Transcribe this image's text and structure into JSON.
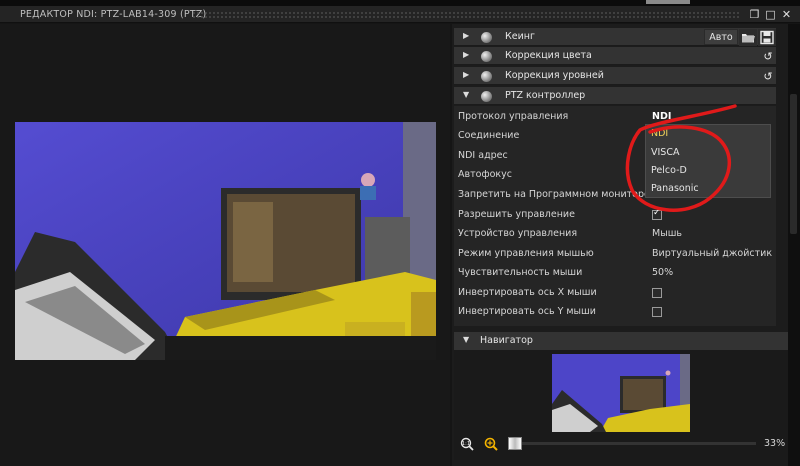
{
  "window": {
    "title": "РЕДАКТОР NDI: PTZ-LAB14-309 (PTZ)",
    "buttons": {
      "restore": "❐",
      "maximize": "□",
      "close": "✕"
    }
  },
  "sections": [
    {
      "label": "Кеинг",
      "expanded": false
    },
    {
      "label": "Коррекция цвета",
      "expanded": false
    },
    {
      "label": "Коррекция уровней",
      "expanded": false
    },
    {
      "label": "PTZ контроллер",
      "expanded": true
    }
  ],
  "toolbar": {
    "auto_label": "Авто",
    "folder_icon": "folder-open-icon",
    "save_icon": "save-icon",
    "reset_icon": "undo-icon"
  },
  "ptz": {
    "rows": [
      {
        "label": "Протокол управления",
        "value": "NDI",
        "type": "select"
      },
      {
        "label": "Соединение",
        "value": "",
        "type": "text"
      },
      {
        "label": "NDI адрес",
        "value": "",
        "type": "text"
      },
      {
        "label": "Автофокус",
        "value": "",
        "type": "checkbox"
      },
      {
        "label": "Запретить на Программном мониторе",
        "value": "",
        "type": "checkbox"
      },
      {
        "label": "Разрешить управление",
        "checked": true,
        "type": "checkbox"
      },
      {
        "label": "Устройство управления",
        "value": "Мышь",
        "type": "select"
      },
      {
        "label": "Режим управления мышью",
        "value": "Виртуальный джойстик",
        "type": "select"
      },
      {
        "label": "Чувствительность мыши",
        "value": "50%",
        "type": "text"
      },
      {
        "label": "Инвертировать ось X мыши",
        "checked": false,
        "type": "checkbox"
      },
      {
        "label": "Инвертировать ось Y мыши",
        "checked": false,
        "type": "checkbox"
      }
    ],
    "protocol_options": [
      "NDI",
      "VISCA",
      "Pelco-D",
      "Panasonic"
    ],
    "selected_option": "NDI"
  },
  "navigator": {
    "label": "Навигатор",
    "zoom": "33%"
  },
  "colors": {
    "accent": "#f4d35a",
    "annotation": "#e01a1a",
    "panel": "#252525"
  }
}
